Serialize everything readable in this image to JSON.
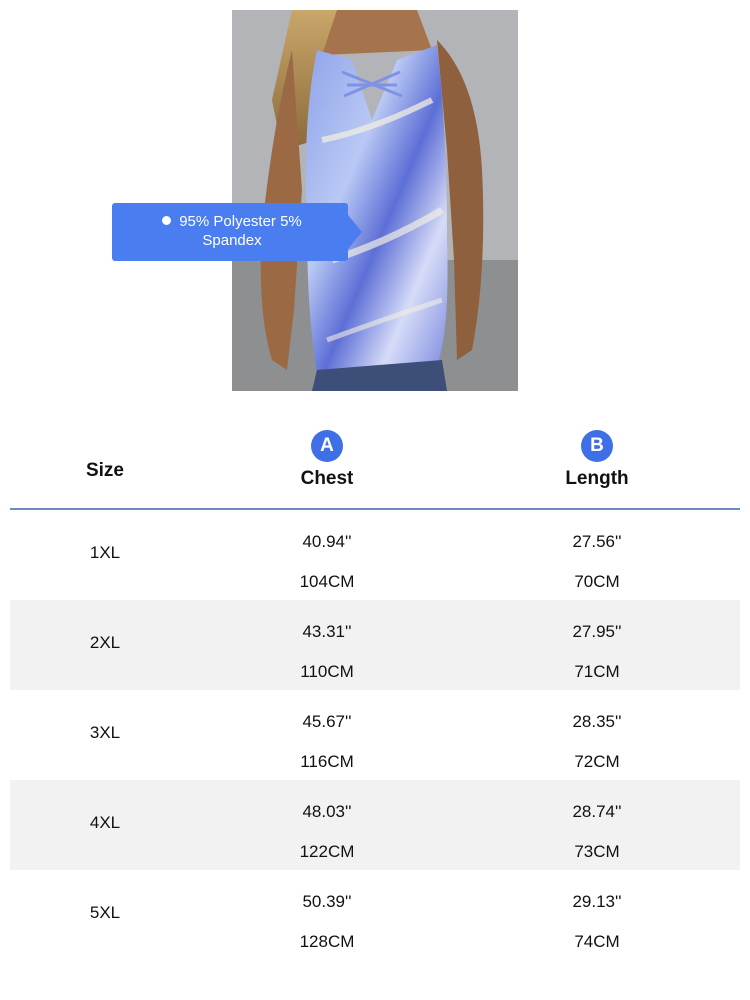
{
  "callout": {
    "icon": "bullet-dot-icon",
    "text_line1": "95% Polyester 5%",
    "text_line2": "Spandex"
  },
  "table": {
    "headers": {
      "size": "Size",
      "chest": "Chest",
      "chest_badge": "A",
      "length": "Length",
      "length_badge": "B"
    },
    "rows": [
      {
        "size": "1XL",
        "chest_in": "40.94''",
        "chest_cm": "104CM",
        "length_in": "27.56''",
        "length_cm": "70CM"
      },
      {
        "size": "2XL",
        "chest_in": "43.31''",
        "chest_cm": "110CM",
        "length_in": "27.95''",
        "length_cm": "71CM"
      },
      {
        "size": "3XL",
        "chest_in": "45.67''",
        "chest_cm": "116CM",
        "length_in": "28.35''",
        "length_cm": "72CM"
      },
      {
        "size": "4XL",
        "chest_in": "48.03''",
        "chest_cm": "122CM",
        "length_in": "28.74''",
        "length_cm": "73CM"
      },
      {
        "size": "5XL",
        "chest_in": "50.39''",
        "chest_cm": "128CM",
        "length_in": "29.13''",
        "length_cm": "74CM"
      }
    ]
  },
  "colors": {
    "accent_blue": "#4a7ef0",
    "badge_blue": "#3f6fe6",
    "divider": "#6b8cbf",
    "row_alt": "#f2f2f2"
  }
}
